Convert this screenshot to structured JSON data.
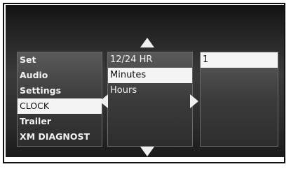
{
  "left_menu": {
    "items": [
      {
        "label": "Set"
      },
      {
        "label": "Audio"
      },
      {
        "label": "Settings"
      },
      {
        "label": "CLOCK",
        "selected": true
      },
      {
        "label": "Trailer"
      },
      {
        "label": "XM DIAGNOST"
      }
    ]
  },
  "middle_menu": {
    "items": [
      {
        "label": "12/24 HR"
      },
      {
        "label": "Minutes",
        "selected": true
      },
      {
        "label": "Hours"
      }
    ]
  },
  "value_panel": {
    "value": "1"
  },
  "icons": {
    "up": "chevron-up-icon",
    "down": "chevron-down-icon",
    "left": "chevron-left-icon",
    "right": "chevron-right-icon"
  },
  "colors": {
    "highlight": "#f4f4f4",
    "panel": "#3b3b3b",
    "text": "#f2f2f2"
  }
}
